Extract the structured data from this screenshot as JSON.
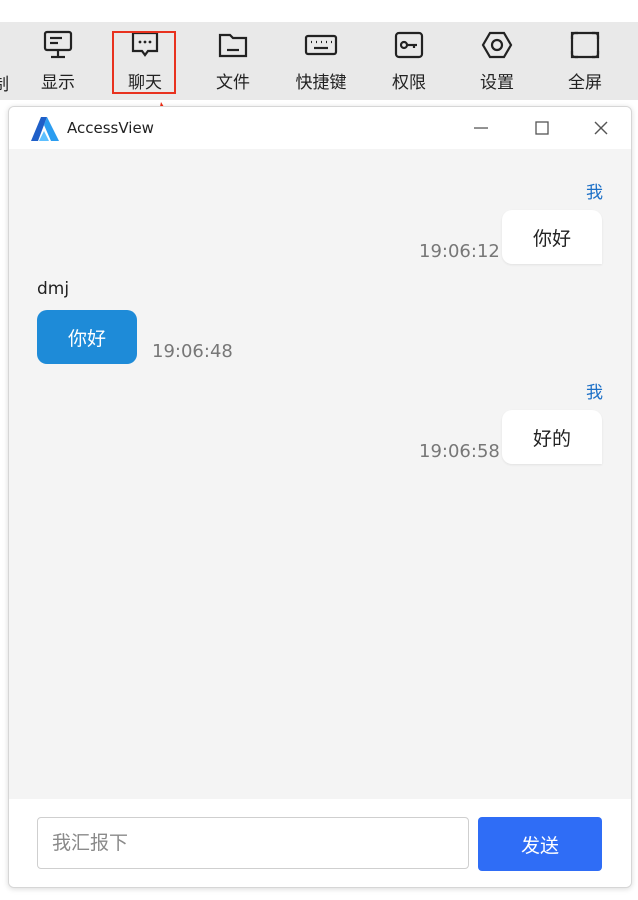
{
  "toolbar": {
    "partial_label": "制",
    "items": [
      {
        "label": "显示",
        "icon": "monitor-icon"
      },
      {
        "label": "聊天",
        "icon": "chat-icon"
      },
      {
        "label": "文件",
        "icon": "folder-icon"
      },
      {
        "label": "快捷键",
        "icon": "keyboard-icon"
      },
      {
        "label": "权限",
        "icon": "key-icon"
      },
      {
        "label": "设置",
        "icon": "settings-icon"
      },
      {
        "label": "全屏",
        "icon": "fullscreen-icon"
      }
    ],
    "highlight_color": "#e8321f"
  },
  "window": {
    "title": "AccessView",
    "brand_color": "#1e8bd8"
  },
  "messages": [
    {
      "sender": "我",
      "text": "你好",
      "time": "19:06:12",
      "direction": "out"
    },
    {
      "sender": "dmj",
      "text": "你好",
      "time": "19:06:48",
      "direction": "in"
    },
    {
      "sender": "我",
      "text": "好的",
      "time": "19:06:58",
      "direction": "out"
    }
  ],
  "composer": {
    "placeholder": "我汇报下",
    "send_label": "发送",
    "send_color": "#2f6df6"
  }
}
